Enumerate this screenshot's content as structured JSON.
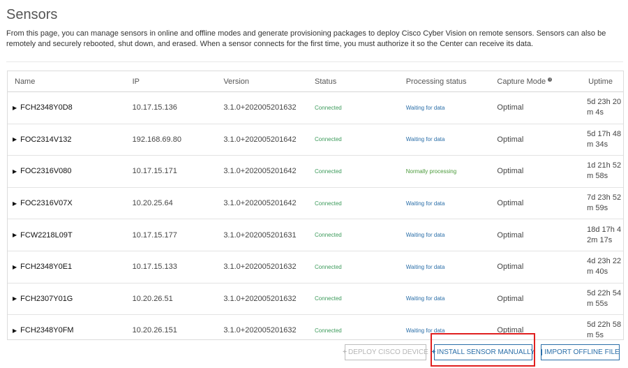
{
  "page": {
    "title": "Sensors",
    "description": "From this page, you can manage sensors in online and offline modes and generate provisioning packages to deploy Cisco Cyber Vision on remote sensors. Sensors can also be remotely and securely rebooted, shut down, and erased. When a sensor connects for the first time, you must authorize it so the Center can receive its data."
  },
  "table": {
    "headers": [
      "Name",
      "IP",
      "Version",
      "Status",
      "Processing status",
      "Capture Mode",
      "Uptime"
    ],
    "rows": [
      {
        "name": "FCH2348Y0D8",
        "ip": "10.17.15.136",
        "version": "3.1.0+202005201632",
        "status": "Connected",
        "processing": "Waiting for data",
        "capture": "Optimal",
        "uptime_l1": "5d 23h 20",
        "uptime_l2": "m 4s"
      },
      {
        "name": "FOC2314V132",
        "ip": "192.168.69.80",
        "version": "3.1.0+202005201642",
        "status": "Connected",
        "processing": "Waiting for data",
        "capture": "Optimal",
        "uptime_l1": "5d 17h 48",
        "uptime_l2": "m 34s"
      },
      {
        "name": "FOC2316V080",
        "ip": "10.17.15.171",
        "version": "3.1.0+202005201642",
        "status": "Connected",
        "processing": "Normally processing",
        "capture": "Optimal",
        "uptime_l1": "1d 21h 52",
        "uptime_l2": "m 58s"
      },
      {
        "name": "FOC2316V07X",
        "ip": "10.20.25.64",
        "version": "3.1.0+202005201642",
        "status": "Connected",
        "processing": "Waiting for data",
        "capture": "Optimal",
        "uptime_l1": "7d 23h 52",
        "uptime_l2": "m 59s"
      },
      {
        "name": "FCW2218L09T",
        "ip": "10.17.15.177",
        "version": "3.1.0+202005201631",
        "status": "Connected",
        "processing": "Waiting for data",
        "capture": "Optimal",
        "uptime_l1": "18d 17h 4",
        "uptime_l2": "2m 17s"
      },
      {
        "name": "FCH2348Y0E1",
        "ip": "10.17.15.133",
        "version": "3.1.0+202005201632",
        "status": "Connected",
        "processing": "Waiting for data",
        "capture": "Optimal",
        "uptime_l1": "4d 23h 22",
        "uptime_l2": "m 40s"
      },
      {
        "name": "FCH2307Y01G",
        "ip": "10.20.26.51",
        "version": "3.1.0+202005201632",
        "status": "Connected",
        "processing": "Waiting for data",
        "capture": "Optimal",
        "uptime_l1": "5d 22h 54",
        "uptime_l2": "m 55s"
      },
      {
        "name": "FCH2348Y0FM",
        "ip": "10.20.26.151",
        "version": "3.1.0+202005201632",
        "status": "Connected",
        "processing": "Waiting for data",
        "capture": "Optimal",
        "uptime_l1": "5d 22h 58",
        "uptime_l2": "m 5s"
      }
    ]
  },
  "buttons": {
    "deploy": "DEPLOY CISCO DEVICE",
    "install": "INSTALL SENSOR MANUALLY",
    "import": "IMPORT OFFLINE FILE"
  },
  "colors": {
    "accent": "#2a6ea8",
    "status_connected": "#3b9a5a",
    "highlight": "#e01f1f"
  }
}
